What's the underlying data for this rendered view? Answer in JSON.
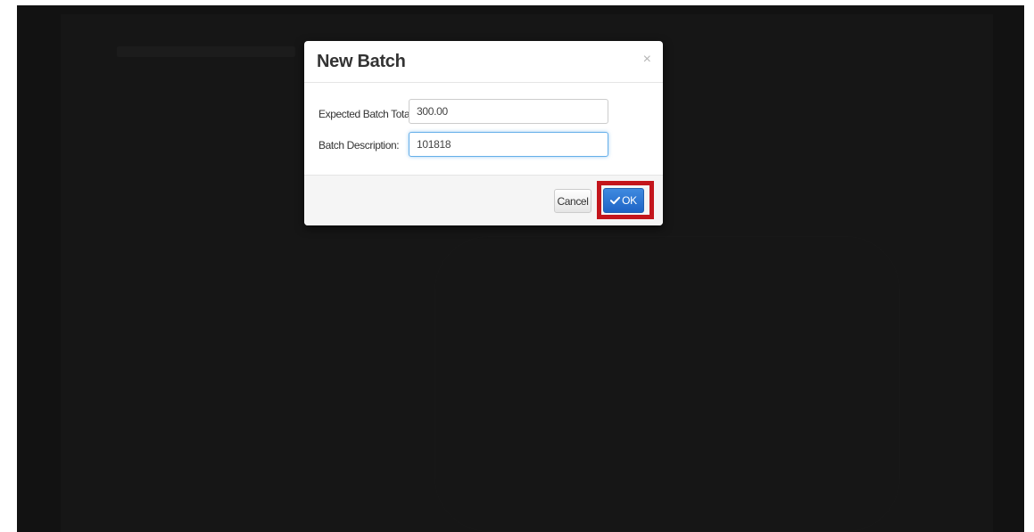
{
  "dialog": {
    "title": "New Batch",
    "close_glyph": "×",
    "fields": {
      "expected_total": {
        "label": "Expected Batch Total:",
        "value": "300.00"
      },
      "description": {
        "label": "Batch Description:",
        "value": "101818"
      }
    },
    "buttons": {
      "cancel_label": "Cancel",
      "ok_label": "OK",
      "ok_icon": "check-icon"
    }
  },
  "colors": {
    "highlight": "#c3151c",
    "primary_button": "#2a72d4",
    "backdrop": "#121212"
  }
}
